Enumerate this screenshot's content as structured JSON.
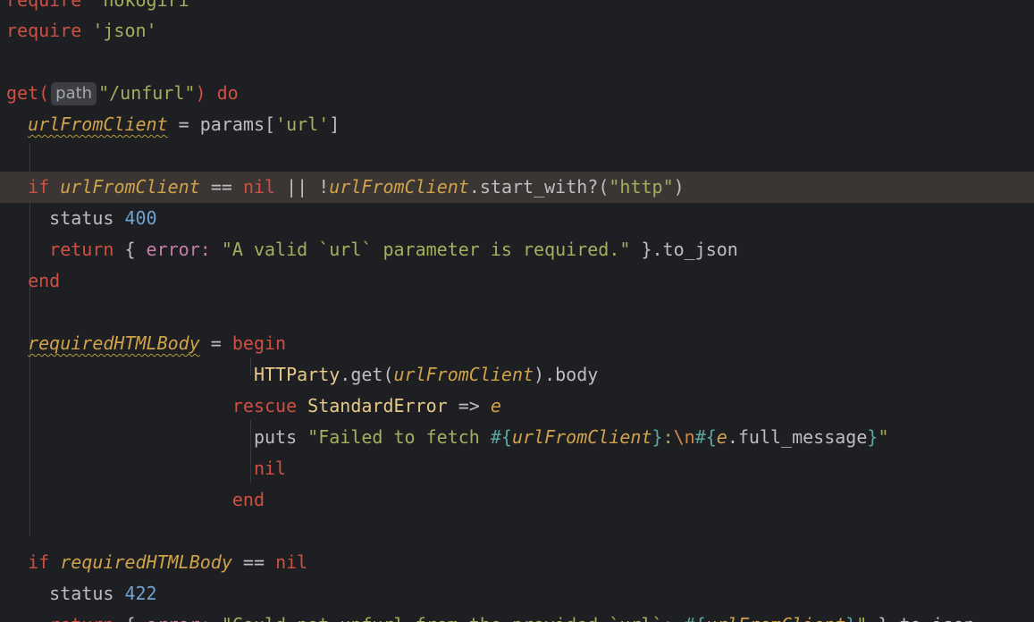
{
  "editor": {
    "language": "ruby",
    "colors": {
      "background": "#1e1f22",
      "current_line": "#3b3634",
      "keyword": "#cf4f43",
      "string": "#a7ad5f",
      "number": "#6fa3d2",
      "variable": "#d0a24a",
      "warning_underline": "#b09a3a"
    },
    "lines": {
      "l0": {
        "t1": "require",
        "t2": "'nokogiri'"
      },
      "l1": {
        "t1": "require",
        "t2": "'json'"
      },
      "l3": {
        "t1": "get(",
        "hint": "path",
        "t2": "\"/unfurl\"",
        "t3": ")",
        "t4": "do"
      },
      "l4": {
        "t1": "urlFromClient",
        "t2": " = params[",
        "t3": "'url'",
        "t4": "]"
      },
      "l6": {
        "t1": "if",
        "t2": "urlFromClient",
        "t3": " == ",
        "t4": "nil",
        "t5": " || !",
        "t6": "urlFromClient",
        "t7": ".start_with?(",
        "t8": "\"http\"",
        "t9": ")"
      },
      "l7": {
        "t1": "status ",
        "t2": "400"
      },
      "l8": {
        "t1": "return",
        "t2": " { ",
        "t3": "error:",
        "t4": " ",
        "t5": "\"A valid `url` parameter is required.\"",
        "t6": " }.to_json"
      },
      "l9": {
        "t1": "end"
      },
      "l11": {
        "t1": "requiredHTMLBody",
        "t2": " = ",
        "t3": "begin"
      },
      "l12": {
        "t1": "HTTParty",
        "t2": ".get(",
        "t3": "urlFromClient",
        "t4": ").body"
      },
      "l13": {
        "t1": "rescue",
        "t2": " ",
        "t3": "StandardError",
        "t4": " => ",
        "t5": "e"
      },
      "l14": {
        "t1": "puts ",
        "t2": "\"Failed to fetch ",
        "t3": "#{",
        "t4": "urlFromClient",
        "t5": "}",
        "t6": ":",
        "t7": "\\n",
        "t8": "#{",
        "t9": "e",
        "t10": ".full_message",
        "t11": "}",
        "t12": "\""
      },
      "l15": {
        "t1": "nil"
      },
      "l16": {
        "t1": "end"
      },
      "l18": {
        "t1": "if",
        "t2": " ",
        "t3": "requiredHTMLBody",
        "t4": " == ",
        "t5": "nil"
      },
      "l19": {
        "t1": "status ",
        "t2": "422"
      },
      "l20": {
        "t1": "return",
        "t2": " { ",
        "t3": "error:",
        "t4": " ",
        "t5": "\"Could not unfurl from the provided `url`: ",
        "t6": "#{",
        "t7": "urlFromClient",
        "t8": "}",
        "t9": "\"",
        "t10": " }.to_json"
      }
    }
  }
}
